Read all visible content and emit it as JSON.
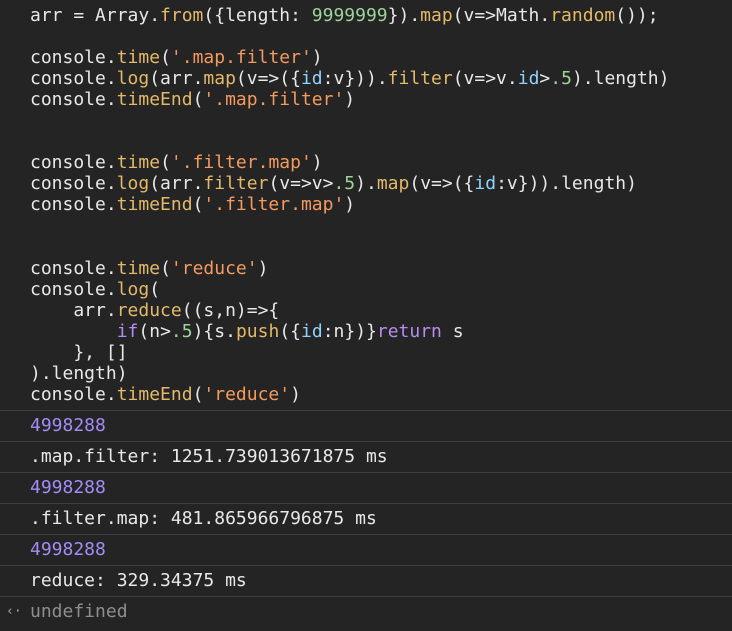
{
  "code_lines": [
    {
      "tokens": [
        {
          "t": "arr = Array.",
          "c": "t-default"
        },
        {
          "t": "from",
          "c": "t-fn"
        },
        {
          "t": "({length: ",
          "c": "t-default"
        },
        {
          "t": "9999999",
          "c": "t-num"
        },
        {
          "t": "}).",
          "c": "t-default"
        },
        {
          "t": "map",
          "c": "t-fn"
        },
        {
          "t": "(v=>Math.",
          "c": "t-default"
        },
        {
          "t": "random",
          "c": "t-fn"
        },
        {
          "t": "());",
          "c": "t-default"
        }
      ]
    },
    {
      "tokens": []
    },
    {
      "tokens": [
        {
          "t": "console.",
          "c": "t-default"
        },
        {
          "t": "time",
          "c": "t-fn"
        },
        {
          "t": "(",
          "c": "t-default"
        },
        {
          "t": "'.map.filter'",
          "c": "t-str"
        },
        {
          "t": ")",
          "c": "t-default"
        }
      ]
    },
    {
      "tokens": [
        {
          "t": "console.",
          "c": "t-default"
        },
        {
          "t": "log",
          "c": "t-fn"
        },
        {
          "t": "(arr.",
          "c": "t-default"
        },
        {
          "t": "map",
          "c": "t-fn"
        },
        {
          "t": "(v=>({",
          "c": "t-default"
        },
        {
          "t": "id",
          "c": "t-id"
        },
        {
          "t": ":v})).",
          "c": "t-default"
        },
        {
          "t": "filter",
          "c": "t-fn"
        },
        {
          "t": "(v=>v.",
          "c": "t-default"
        },
        {
          "t": "id",
          "c": "t-id"
        },
        {
          "t": ">",
          "c": "t-default"
        },
        {
          "t": ".5",
          "c": "t-num"
        },
        {
          "t": ").length)",
          "c": "t-default"
        }
      ]
    },
    {
      "tokens": [
        {
          "t": "console.",
          "c": "t-default"
        },
        {
          "t": "timeEnd",
          "c": "t-fn"
        },
        {
          "t": "(",
          "c": "t-default"
        },
        {
          "t": "'.map.filter'",
          "c": "t-str"
        },
        {
          "t": ")",
          "c": "t-default"
        }
      ]
    },
    {
      "tokens": []
    },
    {
      "tokens": []
    },
    {
      "tokens": [
        {
          "t": "console.",
          "c": "t-default"
        },
        {
          "t": "time",
          "c": "t-fn"
        },
        {
          "t": "(",
          "c": "t-default"
        },
        {
          "t": "'.filter.map'",
          "c": "t-str"
        },
        {
          "t": ")",
          "c": "t-default"
        }
      ]
    },
    {
      "tokens": [
        {
          "t": "console.",
          "c": "t-default"
        },
        {
          "t": "log",
          "c": "t-fn"
        },
        {
          "t": "(arr.",
          "c": "t-default"
        },
        {
          "t": "filter",
          "c": "t-fn"
        },
        {
          "t": "(v=>v>",
          "c": "t-default"
        },
        {
          "t": ".5",
          "c": "t-num"
        },
        {
          "t": ").",
          "c": "t-default"
        },
        {
          "t": "map",
          "c": "t-fn"
        },
        {
          "t": "(v=>({",
          "c": "t-default"
        },
        {
          "t": "id",
          "c": "t-id"
        },
        {
          "t": ":v})).length)",
          "c": "t-default"
        }
      ]
    },
    {
      "tokens": [
        {
          "t": "console.",
          "c": "t-default"
        },
        {
          "t": "timeEnd",
          "c": "t-fn"
        },
        {
          "t": "(",
          "c": "t-default"
        },
        {
          "t": "'.filter.map'",
          "c": "t-str"
        },
        {
          "t": ")",
          "c": "t-default"
        }
      ]
    },
    {
      "tokens": []
    },
    {
      "tokens": []
    },
    {
      "tokens": [
        {
          "t": "console.",
          "c": "t-default"
        },
        {
          "t": "time",
          "c": "t-fn"
        },
        {
          "t": "(",
          "c": "t-default"
        },
        {
          "t": "'reduce'",
          "c": "t-str"
        },
        {
          "t": ")",
          "c": "t-default"
        }
      ]
    },
    {
      "tokens": [
        {
          "t": "console.",
          "c": "t-default"
        },
        {
          "t": "log",
          "c": "t-fn"
        },
        {
          "t": "(",
          "c": "t-default"
        }
      ]
    },
    {
      "tokens": [
        {
          "t": "    arr.",
          "c": "t-default"
        },
        {
          "t": "reduce",
          "c": "t-fn"
        },
        {
          "t": "((s,n)=>{",
          "c": "t-default"
        }
      ]
    },
    {
      "tokens": [
        {
          "t": "        ",
          "c": "t-default"
        },
        {
          "t": "if",
          "c": "t-kw"
        },
        {
          "t": "(n>",
          "c": "t-default"
        },
        {
          "t": ".5",
          "c": "t-num"
        },
        {
          "t": "){s.",
          "c": "t-default"
        },
        {
          "t": "push",
          "c": "t-fn"
        },
        {
          "t": "({",
          "c": "t-default"
        },
        {
          "t": "id",
          "c": "t-id"
        },
        {
          "t": ":n})}",
          "c": "t-default"
        },
        {
          "t": "return",
          "c": "t-kw"
        },
        {
          "t": " s",
          "c": "t-default"
        }
      ]
    },
    {
      "tokens": [
        {
          "t": "    }, []",
          "c": "t-default"
        }
      ]
    },
    {
      "tokens": [
        {
          "t": ").length)",
          "c": "t-default"
        }
      ]
    },
    {
      "tokens": [
        {
          "t": "console.",
          "c": "t-default"
        },
        {
          "t": "timeEnd",
          "c": "t-fn"
        },
        {
          "t": "(",
          "c": "t-default"
        },
        {
          "t": "'reduce'",
          "c": "t-str"
        },
        {
          "t": ")",
          "c": "t-default"
        }
      ]
    }
  ],
  "output": [
    {
      "text": "4998288",
      "kind": "num"
    },
    {
      "text": ".map.filter: 1251.739013671875 ms",
      "kind": "log"
    },
    {
      "text": "4998288",
      "kind": "num"
    },
    {
      "text": ".filter.map: 481.865966796875 ms",
      "kind": "log"
    },
    {
      "text": "4998288",
      "kind": "num"
    },
    {
      "text": "reduce: 329.34375 ms",
      "kind": "log"
    },
    {
      "text": "undefined",
      "kind": "undef",
      "icon": "return-arrow-icon"
    }
  ],
  "icons": {
    "return_arrow": "‹·"
  },
  "colors": {
    "background": "#242424",
    "number_output": "#a48cf7",
    "string": "#f59a5e",
    "function": "#e4b96a",
    "keyword": "#b58cf0"
  }
}
